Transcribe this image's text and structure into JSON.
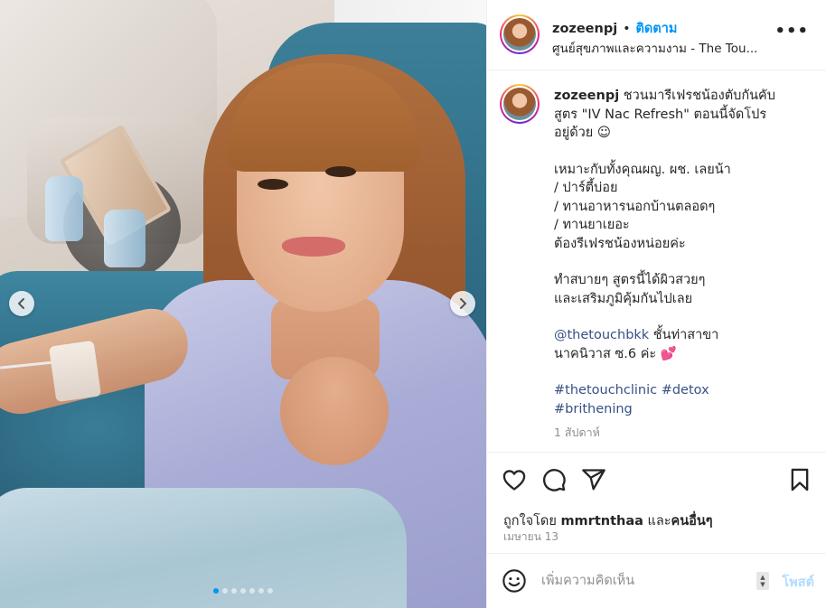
{
  "post": {
    "carousel": {
      "slide_count": 7,
      "active_slide": 1
    }
  },
  "header": {
    "username": "zozeenpj",
    "separator": "•",
    "follow_label": "ติดตาม",
    "location": "ศูนย์สุขภาพและความงาม - The Tou...",
    "more_label": "•••"
  },
  "caption": {
    "username": "zozeenpj",
    "lines": [
      "ชวนมารีเฟรชน้องตับกันคับ",
      "สูตร \"IV Nac Refresh\" ตอนนี้จัดโปร",
      "อยู่ด้วย ☺"
    ],
    "block2": [
      "เหมาะกับทั้งคุณผญ. ผช. เลยน้า",
      "/ ปาร์ตี้บ่อย",
      "/ ทานอาหารนอกบ้านตลอดๆ",
      "/ ทานยาเยอะ",
      "ต้องรีเฟรชน้องหน่อยค่ะ"
    ],
    "block3": [
      "ทำสบายๆ สูตรนี้ได้ผิวสวยๆ",
      "และเสริมภูมิคุ้มกันไปเลย"
    ],
    "mention": "@thetouchbkk",
    "mention_rest": " ชั้นท่าสาขา",
    "mention_line2": "นาคนิวาส ซ.6 ค่ะ",
    "heart": "💕",
    "hashtag1": "#thetouchclinic",
    "hashtag2": "#detox",
    "hashtag3": "#brithening",
    "time_ago": "1 สัปดาห์"
  },
  "actions": {
    "liked_by_prefix": "ถูกใจโดย ",
    "liked_by_user": "mmrtnthaa",
    "liked_by_and": " และ",
    "liked_by_others": "คนอื่นๆ",
    "date": "เมษายน 13"
  },
  "comment": {
    "placeholder": "เพิ่มความคิดเห็น",
    "post_label": "โพสต์"
  },
  "colors": {
    "accent": "#0095f6",
    "link": "#385185",
    "muted": "#8e8e8e",
    "post_disabled": "#b3dbff"
  },
  "icons": [
    "prev-arrow-icon",
    "next-arrow-icon",
    "heart-icon",
    "comment-icon",
    "share-icon",
    "bookmark-icon",
    "emoji-icon",
    "more-icon"
  ]
}
